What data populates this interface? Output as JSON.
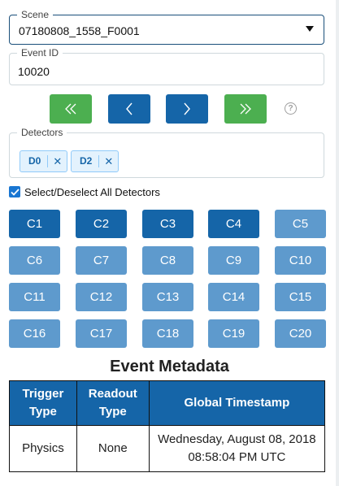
{
  "scene": {
    "label": "Scene",
    "value": "07180808_1558_F0001"
  },
  "event": {
    "label": "Event ID",
    "value": "10020"
  },
  "nav": {
    "first": "«",
    "prev": "‹",
    "next": "›",
    "last": "»",
    "help": "?"
  },
  "detectors": {
    "label": "Detectors",
    "chips": [
      {
        "label": "D0",
        "remove": "✕"
      },
      {
        "label": "D2",
        "remove": "✕"
      }
    ]
  },
  "select_all": {
    "label": "Select/Deselect All Detectors",
    "checked": true
  },
  "channels": [
    {
      "label": "C1",
      "selected": true
    },
    {
      "label": "C2",
      "selected": true
    },
    {
      "label": "C3",
      "selected": true
    },
    {
      "label": "C4",
      "selected": true
    },
    {
      "label": "C5",
      "selected": false
    },
    {
      "label": "C6",
      "selected": false
    },
    {
      "label": "C7",
      "selected": false
    },
    {
      "label": "C8",
      "selected": false
    },
    {
      "label": "C9",
      "selected": false
    },
    {
      "label": "C10",
      "selected": false
    },
    {
      "label": "C11",
      "selected": false
    },
    {
      "label": "C12",
      "selected": false
    },
    {
      "label": "C13",
      "selected": false
    },
    {
      "label": "C14",
      "selected": false
    },
    {
      "label": "C15",
      "selected": false
    },
    {
      "label": "C16",
      "selected": false
    },
    {
      "label": "C17",
      "selected": false
    },
    {
      "label": "C18",
      "selected": false
    },
    {
      "label": "C19",
      "selected": false
    },
    {
      "label": "C20",
      "selected": false
    }
  ],
  "metadata": {
    "title": "Event Metadata",
    "headers": {
      "trigger_1": "Trigger",
      "trigger_2": "Type",
      "readout_1": "Readout",
      "readout_2": "Type",
      "timestamp": "Global Timestamp"
    },
    "row": {
      "trigger": "Physics",
      "readout": "None",
      "timestamp_1": "Wednesday, August 08, 2018",
      "timestamp_2": "08:58:04 PM UTC"
    }
  },
  "colors": {
    "primary": "#1565a8",
    "primary_light": "#5e9acd",
    "success": "#4caf50",
    "chip_bg": "#e3f2fd"
  }
}
